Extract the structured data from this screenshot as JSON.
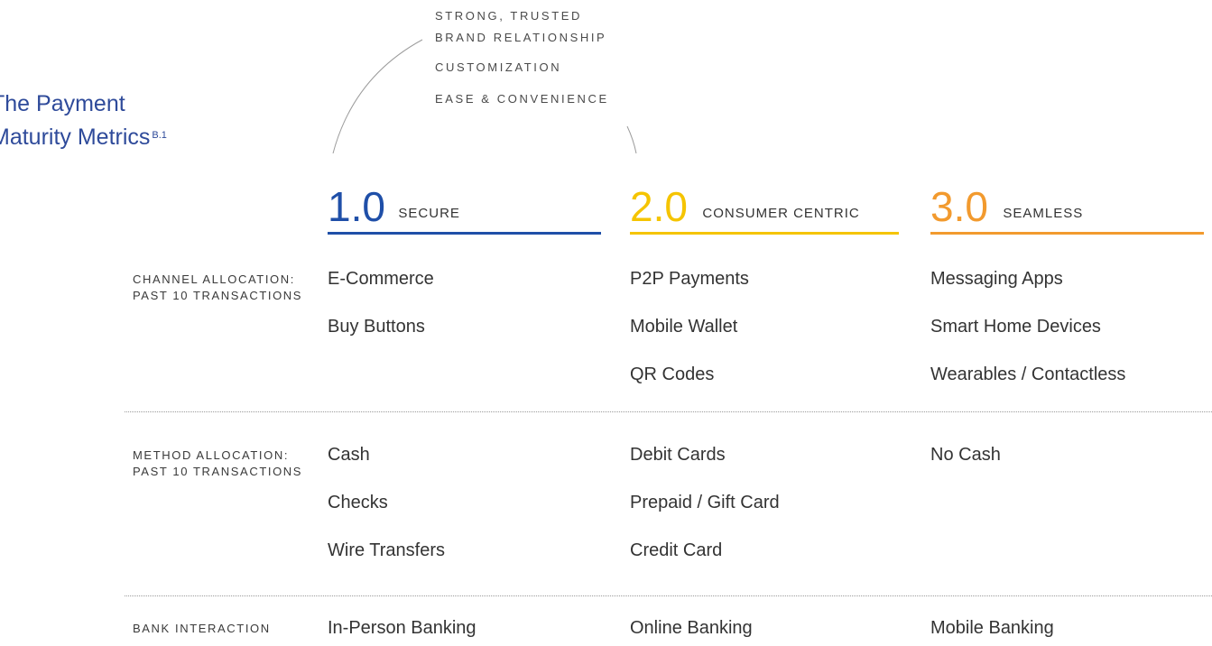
{
  "title": {
    "line1": "The Payment",
    "line2": "Maturity Metrics",
    "superscript": "B.1"
  },
  "attributes": [
    "STRONG, TRUSTED",
    "BRAND RELATIONSHIP",
    "CUSTOMIZATION",
    "EASE & CONVENIENCE"
  ],
  "tiers": [
    {
      "number": "1.0",
      "label": "SECURE",
      "color": "#1f4fa8"
    },
    {
      "number": "2.0",
      "label": "CONSUMER CENTRIC",
      "color": "#f5c400"
    },
    {
      "number": "3.0",
      "label": "SEAMLESS",
      "color": "#f29a2e"
    }
  ],
  "rows": [
    {
      "label_line1": "CHANNEL ALLOCATION:",
      "label_line2": "PAST 10 TRANSACTIONS",
      "cells": [
        [
          "E-Commerce",
          "Buy Buttons"
        ],
        [
          "P2P Payments",
          "Mobile Wallet",
          "QR Codes"
        ],
        [
          "Messaging Apps",
          "Smart Home Devices",
          "Wearables / Contactless"
        ]
      ]
    },
    {
      "label_line1": "METHOD ALLOCATION:",
      "label_line2": "PAST 10 TRANSACTIONS",
      "cells": [
        [
          "Cash",
          "Checks",
          "Wire Transfers"
        ],
        [
          "Debit Cards",
          "Prepaid / Gift Card",
          "Credit Card"
        ],
        [
          "No Cash"
        ]
      ]
    },
    {
      "label_line1": "BANK INTERACTION",
      "label_line2": "",
      "cells": [
        [
          "In-Person Banking"
        ],
        [
          "Online Banking"
        ],
        [
          "Mobile Banking"
        ]
      ]
    }
  ]
}
